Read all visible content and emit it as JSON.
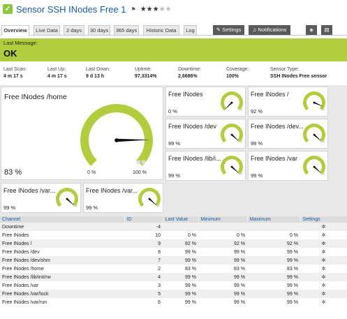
{
  "header": {
    "title": "Sensor SSH INodes Free 1",
    "flag_icon": "flag-icon",
    "stars_filled": 3,
    "stars_total": 5
  },
  "tabs": [
    {
      "label": "Overview",
      "active": true
    },
    {
      "label": "Live Data"
    },
    {
      "label": "2 days"
    },
    {
      "label": "30 days"
    },
    {
      "label": "365 days"
    },
    {
      "label": "Historic Data"
    },
    {
      "label": "Log"
    }
  ],
  "toolbar": {
    "settings_label": "Settings",
    "notifications_label": "Notifications"
  },
  "status": {
    "label": "Last Message:",
    "value": "OK",
    "color": "#b1cd3e"
  },
  "stats": [
    {
      "key": "Last Scan:",
      "value": "4 m 17 s"
    },
    {
      "key": "Last Up:",
      "value": "4 m 17 s"
    },
    {
      "key": "Last Down:",
      "value": "9 d 13 h"
    },
    {
      "key": "Uptime:",
      "value": "97,3314%"
    },
    {
      "key": "Downtime:",
      "value": "2,6686%"
    },
    {
      "key": "Coverage:",
      "value": "100%"
    },
    {
      "key": "Sensor Type:",
      "value": "SSH INodes Free sensor"
    }
  ],
  "main_gauge": {
    "name": "Free INodes /home",
    "value_text": "83 %",
    "fraction": 0.83,
    "min_label": "0 %",
    "max_label": "100 %",
    "color": "#b1cd3e"
  },
  "small_gauges": [
    {
      "name": "Free INodes",
      "value_text": "0 %",
      "fraction": 0.0
    },
    {
      "name": "Free INodes /",
      "value_text": "92 %",
      "fraction": 0.92
    },
    {
      "name": "Free INodes /dev",
      "value_text": "99 %",
      "fraction": 0.99
    },
    {
      "name": "Free INodes /dev...",
      "value_text": "99 %",
      "fraction": 0.99
    },
    {
      "name": "Free INodes /lib/i...",
      "value_text": "99 %",
      "fraction": 0.99
    },
    {
      "name": "Free INodes /var",
      "value_text": "99 %",
      "fraction": 0.99
    },
    {
      "name": "Free INodes /var...",
      "value_text": "99 %",
      "fraction": 0.99
    },
    {
      "name": "Free INodes /var...",
      "value_text": "99 %",
      "fraction": 0.99
    }
  ],
  "table": {
    "headers": [
      "Channel",
      "ID",
      "Last Value",
      "Minimum",
      "Maximum",
      "Settings"
    ],
    "rows": [
      {
        "channel": "Downtime",
        "id": "-4",
        "last": "",
        "min": "",
        "max": ""
      },
      {
        "channel": "Free INodes",
        "id": "10",
        "last": "0 %",
        "min": "0 %",
        "max": "0 %"
      },
      {
        "channel": "Free INodes /",
        "id": "9",
        "last": "92 %",
        "min": "92 %",
        "max": "92 %"
      },
      {
        "channel": "Free INodes /dev",
        "id": "8",
        "last": "99 %",
        "min": "99 %",
        "max": "99 %"
      },
      {
        "channel": "Free INodes /dev/shm",
        "id": "7",
        "last": "99 %",
        "min": "99 %",
        "max": "99 %"
      },
      {
        "channel": "Free INodes /home",
        "id": "2",
        "last": "83 %",
        "min": "83 %",
        "max": "83 %"
      },
      {
        "channel": "Free INodes /lib/init/rw",
        "id": "4",
        "last": "99 %",
        "min": "99 %",
        "max": "99 %"
      },
      {
        "channel": "Free INodes /var",
        "id": "3",
        "last": "99 %",
        "min": "99 %",
        "max": "99 %"
      },
      {
        "channel": "Free INodes /var/lock",
        "id": "5",
        "last": "99 %",
        "min": "99 %",
        "max": "99 %"
      },
      {
        "channel": "Free INodes /var/run",
        "id": "6",
        "last": "99 %",
        "min": "99 %",
        "max": "99 %"
      }
    ]
  },
  "colors": {
    "accent": "#b1cd3e",
    "title": "#1a5a9a",
    "button_dark": "#5a5a5a"
  }
}
